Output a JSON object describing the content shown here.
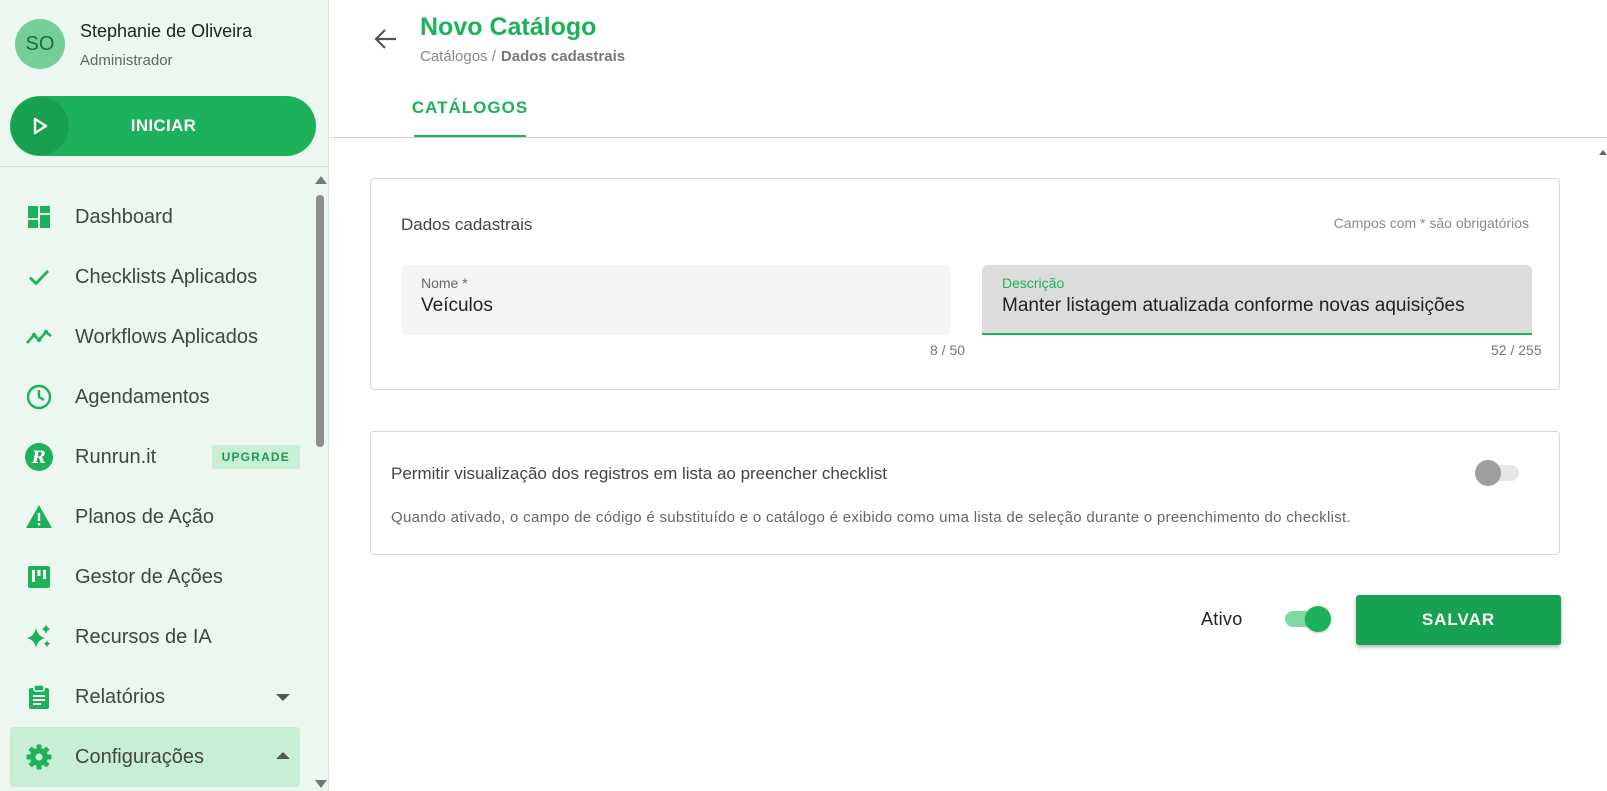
{
  "user": {
    "initials": "SO",
    "name": "Stephanie de Oliveira",
    "role": "Administrador"
  },
  "start_button": {
    "label": "INICIAR"
  },
  "sidebar": {
    "items": [
      {
        "label": "Dashboard",
        "icon": "dashboard-icon"
      },
      {
        "label": "Checklists Aplicados",
        "icon": "check-icon"
      },
      {
        "label": "Workflows Aplicados",
        "icon": "trending-icon"
      },
      {
        "label": "Agendamentos",
        "icon": "clock-icon"
      },
      {
        "label": "Runrun.it",
        "icon": "runrun-icon",
        "badge": "UPGRADE"
      },
      {
        "label": "Planos de Ação",
        "icon": "warning-icon"
      },
      {
        "label": "Gestor de Ações",
        "icon": "kanban-icon"
      },
      {
        "label": "Recursos de IA",
        "icon": "sparkle-icon"
      },
      {
        "label": "Relatórios",
        "icon": "clipboard-icon"
      },
      {
        "label": "Configurações",
        "icon": "gear-icon"
      }
    ]
  },
  "header": {
    "title": "Novo Catálogo",
    "breadcrumb": {
      "parent": "Catálogos /",
      "current": "Dados cadastrais"
    },
    "tab": "CATÁLOGOS"
  },
  "form": {
    "section_title": "Dados cadastrais",
    "required_note": "Campos com * são obrigatórios",
    "name": {
      "label": "Nome *",
      "value": "Veículos",
      "counter": "8 / 50"
    },
    "description": {
      "label": "Descrição",
      "value": "Manter listagem atualizada conforme novas aquisições",
      "counter": "52 / 255"
    }
  },
  "option": {
    "title": "Permitir visualização dos registros em lista ao preencher checklist",
    "description": "Quando ativado, o campo de código é substituído e o catálogo é exibido como uma lista de seleção durante o preenchimento do checklist.",
    "enabled": false
  },
  "footer": {
    "active_label": "Ativo",
    "active": true,
    "save_label": "SALVAR"
  },
  "colors": {
    "accent": "#1db15c",
    "sidebar_bg": "#ecf7f0",
    "active_item": "#c9eed6"
  }
}
